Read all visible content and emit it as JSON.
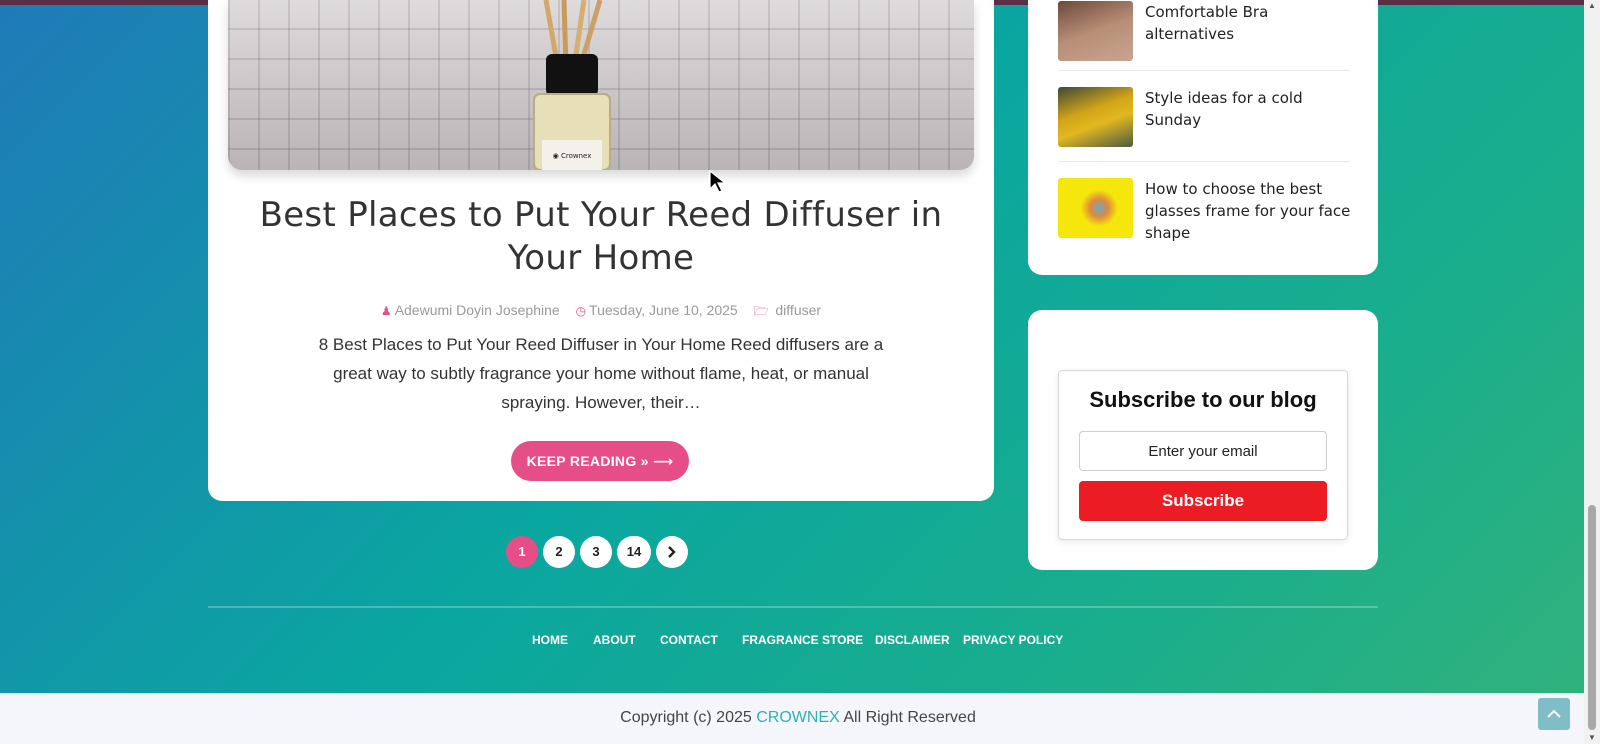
{
  "post": {
    "title": "Best Places to Put Your Reed Diffuser in Your Home",
    "author": "Adewumi Doyin Josephine",
    "date": "Tuesday, June 10, 2025",
    "category": "diffuser",
    "excerpt": "8 Best Places to Put Your Reed Diffuser in Your Home Reed diffusers are a great way to subtly fragrance your home without flame, heat, or manual spraying. However, their…",
    "keep_reading_label": "KEEP READING » ⟶"
  },
  "pagination": {
    "pages": [
      "1",
      "2",
      "3",
      "14"
    ],
    "active": "1",
    "next_icon": "chevron-right-icon"
  },
  "recent_posts": [
    {
      "title": "Comfortable Bra alternatives"
    },
    {
      "title": "Style ideas for a cold Sunday"
    },
    {
      "title": "How to choose the best glasses frame for your face shape"
    }
  ],
  "subscribe": {
    "title": "Subscribe to our blog",
    "email_placeholder": "Enter your email",
    "button_label": "Subscribe"
  },
  "footer": {
    "links": [
      "HOME",
      "ABOUT",
      "CONTACT",
      "FRAGRANCE STORE",
      "DISCLAIMER",
      "PRIVACY POLICY"
    ],
    "copyright_prefix": "Copyright (c) 2025",
    "brand": "CROWNEX",
    "copyright_suffix": "All Right Reserved"
  },
  "colors": {
    "accent_pink": "#e64e87",
    "subscribe_red": "#ec1c24",
    "brand_teal": "#2bb0b8"
  }
}
